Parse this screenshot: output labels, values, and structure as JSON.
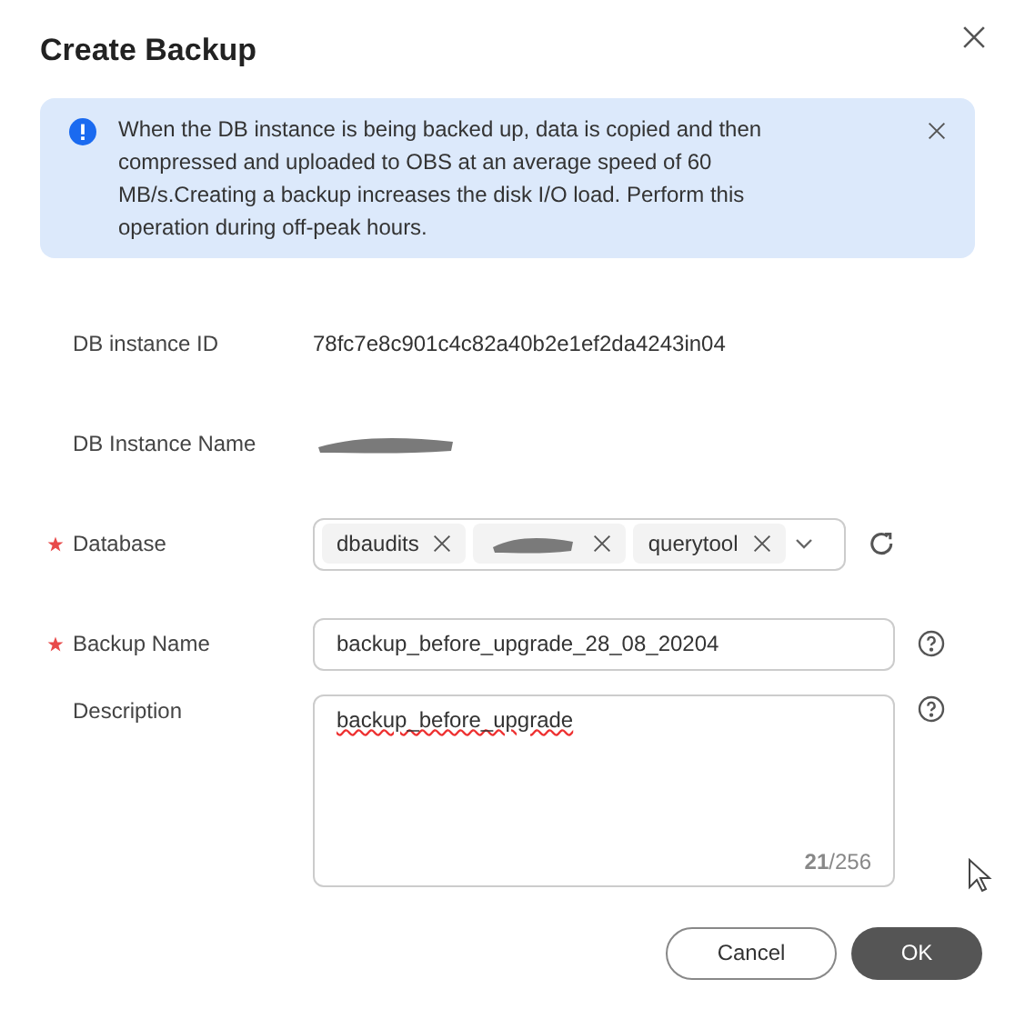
{
  "dialog": {
    "title": "Create Backup"
  },
  "alert": {
    "text": "When the DB instance is being backed up, data is copied and then compressed and uploaded to OBS at an average speed of 60 MB/s.Creating a backup increases the disk I/O load. Perform this operation during off-peak hours."
  },
  "fields": [
    {
      "kind": "text",
      "label": "DB instance ID",
      "required": false,
      "value": "78fc7e8c901c4c82a40b2e1ef2da4243in04"
    },
    {
      "kind": "redacted",
      "label": "DB Instance Name",
      "required": false
    },
    {
      "kind": "tags",
      "label": "Database",
      "required": true,
      "tags": [
        {
          "kind": "text",
          "text": "dbaudits"
        },
        {
          "kind": "redacted"
        },
        {
          "kind": "text",
          "text": "querytool"
        }
      ]
    },
    {
      "kind": "input",
      "label": "Backup Name",
      "required": true,
      "value": "backup_before_upgrade_28_08_20204"
    },
    {
      "kind": "textarea",
      "label": "Description",
      "required": false,
      "value": "backup_before_upgrade",
      "counter": "**21**/256"
    }
  ],
  "buttons": [
    {
      "kind": "secondary",
      "label": "Cancel"
    },
    {
      "kind": "primary",
      "label": "OK"
    }
  ]
}
